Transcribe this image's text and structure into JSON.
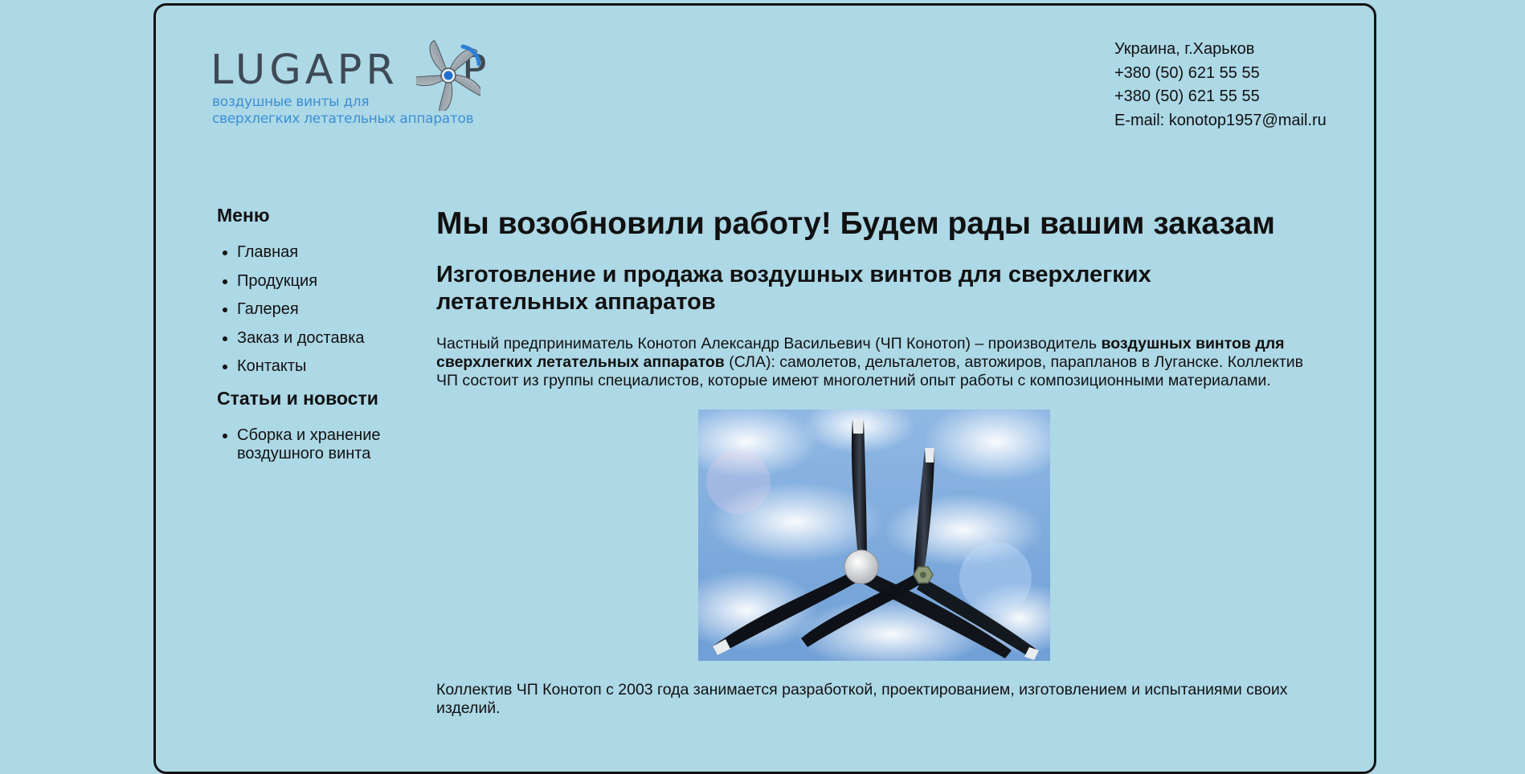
{
  "header": {
    "logo": {
      "wordmark": "LUGAPROP",
      "tagline_line1": "воздушные винты для",
      "tagline_line2": "сверхлегких летательных аппаратов"
    },
    "contacts": {
      "location": "Украина, г.Харьков",
      "phone1": "+380 (50) 621 55 55",
      "phone2": "+380 (50) 621 55 55",
      "email": "E-mail: konotop1957@mail.ru"
    }
  },
  "sidebar": {
    "menu_title": "Меню",
    "menu_items": [
      {
        "label": "Главная"
      },
      {
        "label": "Продукция"
      },
      {
        "label": "Галерея"
      },
      {
        "label": "Заказ и доставка"
      },
      {
        "label": "Контакты"
      }
    ],
    "news_title": "Статьи и новости",
    "news_items": [
      {
        "label": "Сборка и хранение воздушного винта"
      }
    ]
  },
  "main": {
    "headline": "Мы возобновили работу! Будем рады вашим заказам",
    "subheadline": "Изготовление и продажа воздушных винтов для сверхлегких летательных аппаратов",
    "intro": {
      "before_bold": "Частный предприниматель Конотоп Александр Васильевич (ЧП Конотоп) – производитель ",
      "bold": "воздушных винтов для сверхлегких летательных аппаратов",
      "after_bold": " (СЛА): самолетов, дельталетов, автожиров, парапланов в Луганске. Коллектив ЧП состоит из группы специалистов, которые имеют многолетний опыт работы с композиционными материалами."
    },
    "outro": "Коллектив ЧП Конотоп с 2003 года занимается разработкой, проектированием, изготовлением и испытаниями своих изделий."
  },
  "colors": {
    "background": "#add8e6",
    "logo_text": "#3e4a55",
    "logo_tagline": "#3a8fd6",
    "text": "#111111"
  }
}
